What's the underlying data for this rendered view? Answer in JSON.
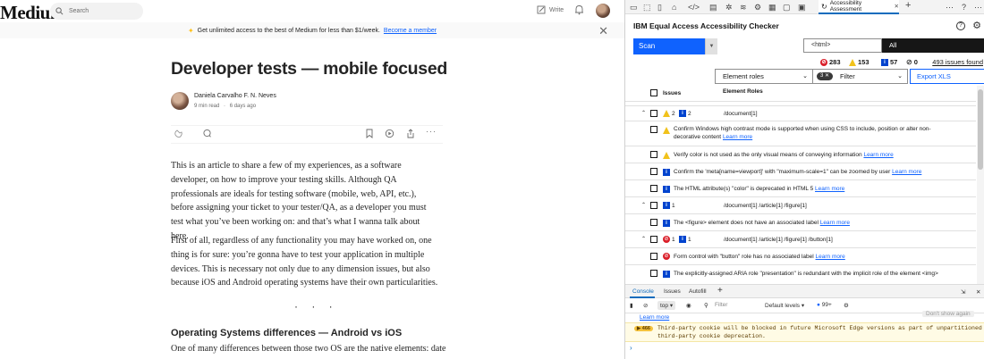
{
  "medium": {
    "logo": "Medium",
    "search_placeholder": "Search",
    "write_label": "Write",
    "banner_text": "Get unlimited access to the best of Medium for less than $1/week.",
    "banner_link": "Become a member",
    "title": "Developer tests — mobile focused",
    "author": "Daniela Carvalho F. N. Neves",
    "read_time": "9 min read",
    "dot": "·",
    "posted": "6 days ago",
    "paragraph1": "This is an article to share a few of my experiences, as a software developer, on how to improve your testing skills. Although QA professionals are ideals for testing software (mobile, web, API, etc.), before assigning your ticket to your tester/QA, as a developer you must test what you’ve been working on: and that’s what I wanna talk about here.",
    "paragraph2": "First of all, regardless of any functionality you may have worked on, one thing is for sure: you’re gonna have to test your application in multiple devices. This is necessary not only due to any dimension issues, but also because iOS and Android operating systems have their own particularities.",
    "divider": "· · ·",
    "heading2": "Operating Systems differences — Android vs iOS",
    "paragraph3": "One of many differences between those two OS are the native elements: date"
  },
  "devtools": {
    "active_tab": "Accessibility Assessment",
    "checker_title": "IBM Equal Access Accessibility Checker",
    "scan_label": "Scan",
    "element_select": "<html>",
    "scope_label": "All",
    "counts": {
      "violations": "283",
      "needs_review": "153",
      "recommendations": "57",
      "hidden": "0"
    },
    "issues_found": "493 issues found",
    "roles_label": "Element roles",
    "filter_count": "3",
    "filter_label": "Filter",
    "export_label": "Export XLS",
    "table_headers": {
      "issues": "Issues",
      "roles": "Element Roles"
    },
    "rows": [
      {
        "type": "group",
        "w": "2",
        "i": "2",
        "path": "/document[1]"
      },
      {
        "type": "item",
        "icon": "warning",
        "text": "Confirm Windows high contrast mode is supported when using CSS to include, position or alter non-",
        "text2": "decorative content",
        "link": "Learn more"
      },
      {
        "type": "item",
        "icon": "warning",
        "text": "Verify color is not used as the only visual means of conveying information",
        "link": "Learn more"
      },
      {
        "type": "item",
        "icon": "info",
        "text": "Confirm the 'meta[name=viewport]' with \"maximum-scale=1\" can be zoomed by user",
        "link": "Learn more"
      },
      {
        "type": "item",
        "icon": "info",
        "text": "The HTML attribute(s) \"color\" is deprecated in HTML 5",
        "link": "Learn more"
      },
      {
        "type": "group",
        "i": "1",
        "path": "/document[1] /article[1] /figure[1]"
      },
      {
        "type": "item",
        "icon": "info",
        "text": "The <figure> element does not have an associated label",
        "link": "Learn more"
      },
      {
        "type": "group",
        "v": "1",
        "i": "1",
        "path": "/document[1] /article[1] /figure[1] /button[1]"
      },
      {
        "type": "item",
        "icon": "violation",
        "text": "Form control with \"button\" role has no associated label",
        "link": "Learn more"
      },
      {
        "type": "item",
        "icon": "info",
        "text": "The explicitly-assigned ARIA role \"presentation\" is redundant with the implicit role of the element <img>",
        "link": ""
      }
    ],
    "console_tabs": [
      "Console",
      "Issues",
      "Autofill"
    ],
    "context": "top",
    "filter_placeholder": "Filter",
    "levels": "Default levels",
    "issue_count": "99+",
    "learn_more": "Learn more",
    "dont_show": "Don't show again",
    "warn_count": "466",
    "warn_line1": "Third-party cookie will be blocked in future Microsoft Edge versions as part of unpartitioned",
    "warn_line2": "third-party cookie deprecation.",
    "prompt": "›"
  },
  "colors": {
    "accent": "#0f62fe",
    "violation": "#da1e28",
    "warning": "#f1c21b",
    "info": "#0043ce",
    "edge_blue": "#0f6cbd"
  },
  "icons": [
    "search-icon",
    "write-icon",
    "bell-icon",
    "close-icon",
    "clap-icon",
    "comment-icon",
    "bookmark-icon",
    "play-icon",
    "share-icon",
    "more-icon",
    "help-icon",
    "gear-icon",
    "chevron-down-icon",
    "chevron-up-icon",
    "filter-icon",
    "eye-icon"
  ]
}
